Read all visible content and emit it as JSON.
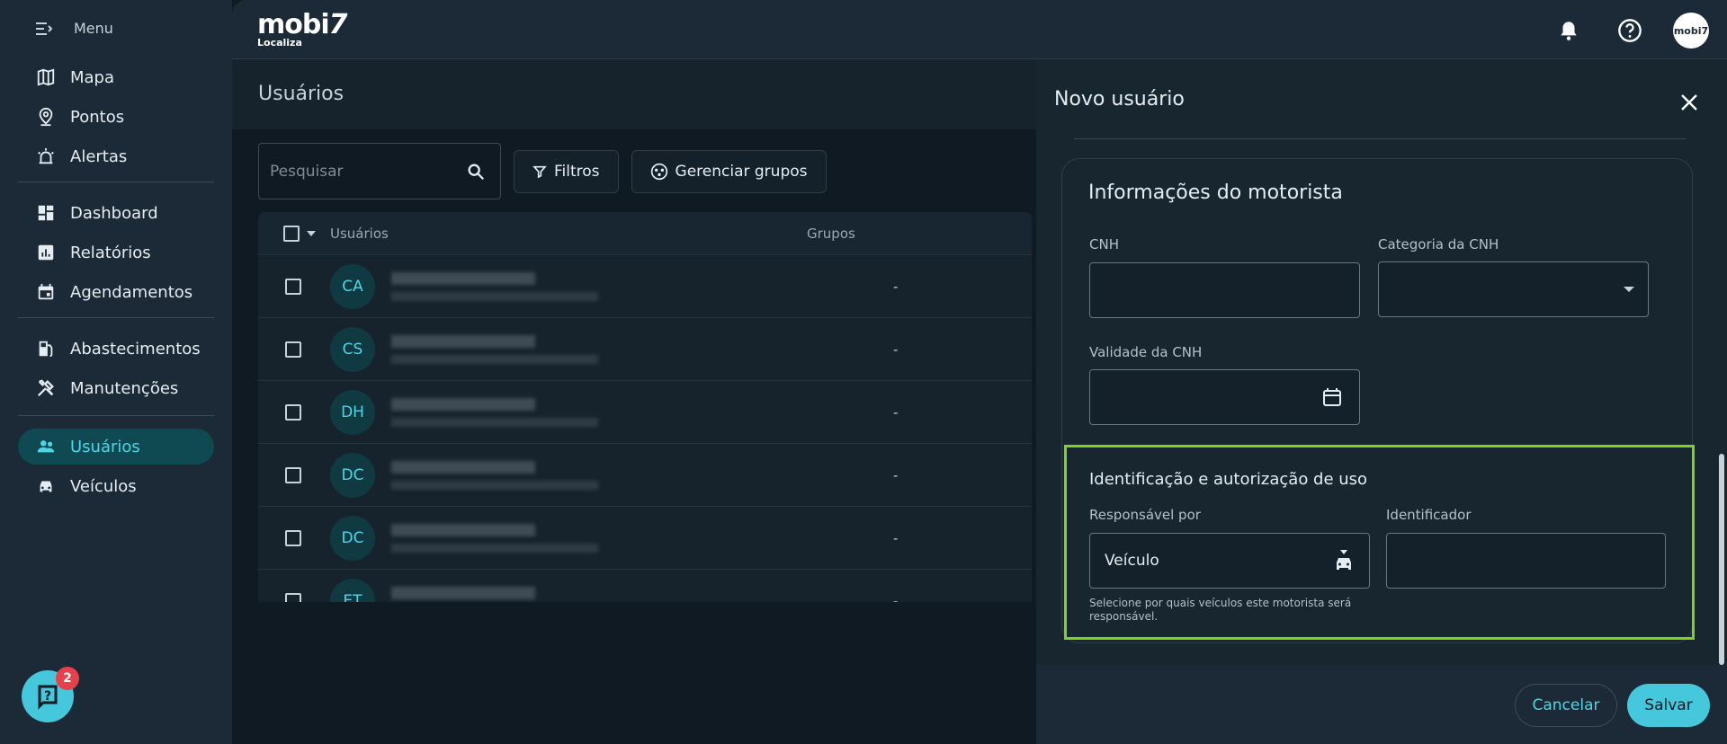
{
  "sidebar": {
    "menu_label": "Menu",
    "items": [
      {
        "label": "Mapa",
        "icon": "map-icon"
      },
      {
        "label": "Pontos",
        "icon": "pin-icon"
      },
      {
        "label": "Alertas",
        "icon": "alert-light-icon"
      },
      {
        "label": "Dashboard",
        "icon": "dashboard-icon"
      },
      {
        "label": "Relatórios",
        "icon": "report-icon"
      },
      {
        "label": "Agendamentos",
        "icon": "calendar-icon"
      },
      {
        "label": "Abastecimentos",
        "icon": "fuel-icon"
      },
      {
        "label": "Manutenções",
        "icon": "tools-icon"
      },
      {
        "label": "Usuários",
        "icon": "people-icon"
      },
      {
        "label": "Veículos",
        "icon": "car-icon"
      }
    ],
    "help_badge": "2"
  },
  "header": {
    "logo": "mobi",
    "logo_seven": "7",
    "logo_sub": "Localiza",
    "avatar_text": "mobi7"
  },
  "main": {
    "title": "Usuários",
    "search_placeholder": "Pesquisar",
    "filters_label": "Filtros",
    "groups_label": "Gerenciar grupos",
    "table": {
      "col_users": "Usuários",
      "col_groups": "Grupos",
      "rows": [
        {
          "initials": "CA",
          "groups": "-"
        },
        {
          "initials": "CS",
          "groups": "-"
        },
        {
          "initials": "DH",
          "groups": "-"
        },
        {
          "initials": "DC",
          "groups": "-"
        },
        {
          "initials": "DC",
          "groups": "-"
        },
        {
          "initials": "ET",
          "groups": "-"
        }
      ]
    }
  },
  "panel": {
    "title": "Novo usuário",
    "driver_section": "Informações do motorista",
    "cnh_label": "CNH",
    "cnh_value": "",
    "cnh_category_label": "Categoria da CNH",
    "cnh_category_value": "",
    "cnh_validity_label": "Validade da CNH",
    "cnh_validity_value": "",
    "id_section": "Identificação e autorização de uso",
    "responsible_label": "Responsável por",
    "responsible_value": "Veículo",
    "identifier_label": "Identificador",
    "identifier_value": "",
    "hint": "Selecione por quais veículos este motorista será responsável.",
    "cancel_label": "Cancelar",
    "save_label": "Salvar"
  },
  "colors": {
    "accent": "#45c8dc",
    "highlight": "#7ed321",
    "sidebar_bg": "#1b2a36"
  }
}
